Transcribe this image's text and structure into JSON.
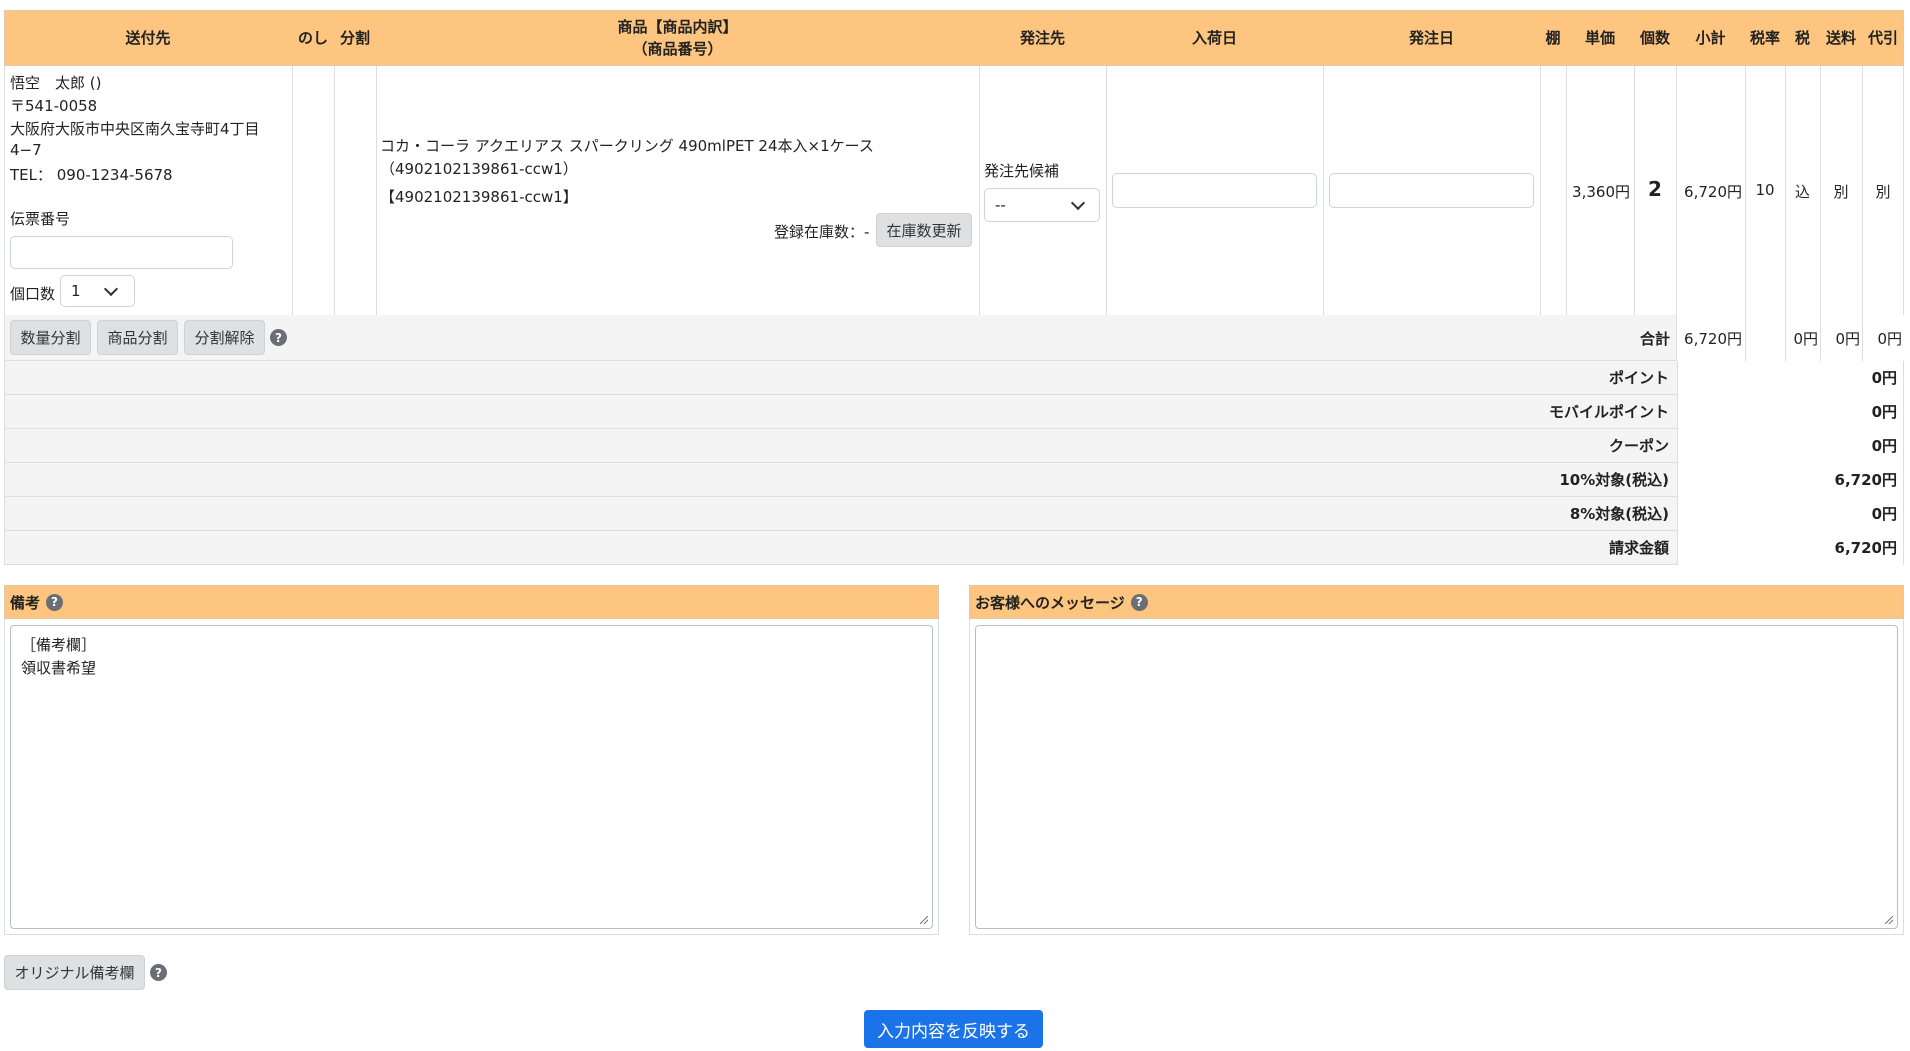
{
  "table_headers": {
    "recipient": "送付先",
    "noshi": "のし",
    "split": "分割",
    "product": "商品【商品内訳】",
    "product_sub": "（商品番号）",
    "order_to": "発注先",
    "arrival_date": "入荷日",
    "order_date": "発注日",
    "shelf": "棚",
    "unit_price": "単価",
    "quantity": "個数",
    "subtotal": "小計",
    "tax_rate": "税率",
    "tax": "税",
    "shipping": "送料",
    "cod": "代引"
  },
  "recipient": {
    "name": "悟空　太郎 ()",
    "postal": "〒541-0058",
    "address1": "大阪府大阪市中央区南久宝寺町4丁目",
    "address2": "4−7",
    "tel": "TEL： 090-1234-5678",
    "slip_label": "伝票番号",
    "slip_value": "",
    "parcel_label": "個口数",
    "parcel_value": "1"
  },
  "product": {
    "name": "コカ・コーラ アクエリアス スパークリング 490mlPET 24本入×1ケース",
    "code_paren": "（4902102139861-ccw1）",
    "code_bracket": "【4902102139861-ccw1】",
    "stock_label": "登録在庫数：-",
    "stock_button": "在庫数更新"
  },
  "order_to": {
    "candidate_label": "発注先候補",
    "select_value": "--"
  },
  "arrival_date_value": "",
  "order_date_value": "",
  "line": {
    "unit_price": "3,360円",
    "quantity": "2",
    "subtotal": "6,720円",
    "tax_rate": "10",
    "tax": "込",
    "shipping": "別",
    "cod": "別"
  },
  "actions": {
    "qty_split": "数量分割",
    "item_split": "商品分割",
    "split_cancel": "分割解除"
  },
  "totals_row": {
    "label": "合計",
    "subtotal": "6,720円",
    "tax": "0円",
    "shipping": "0円",
    "cod": "0円"
  },
  "summary": [
    {
      "label": "ポイント",
      "value": "0円"
    },
    {
      "label": "モバイルポイント",
      "value": "0円"
    },
    {
      "label": "クーポン",
      "value": "0円"
    },
    {
      "label": "10%対象(税込)",
      "value": "6,720円"
    },
    {
      "label": "8%対象(税込)",
      "value": "0円"
    },
    {
      "label": "請求金額",
      "value": "6,720円"
    }
  ],
  "remarks": {
    "title": "備考",
    "text": "［備考欄］\n領収書希望"
  },
  "customer_message": {
    "title": "お客様へのメッセージ",
    "text": ""
  },
  "original_remarks_button": "オリジナル備考欄",
  "submit_button": "入力内容を反映する",
  "help_glyph": "?",
  "colors": {
    "header_bg": "#fdc57f",
    "primary": "#1a73e8",
    "gray_button": "#dfe0e2"
  }
}
